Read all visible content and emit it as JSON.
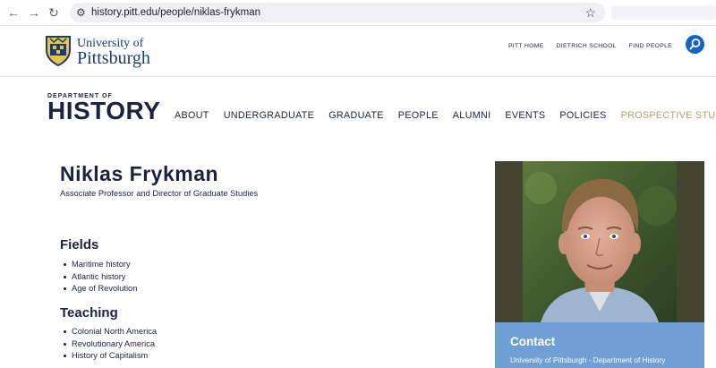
{
  "browser": {
    "url": "history.pitt.edu/people/niklas-frykman"
  },
  "university": {
    "line1": "University of",
    "line2": "Pittsburgh"
  },
  "top_links": [
    "PITT HOME",
    "DIETRICH SCHOOL",
    "FIND PEOPLE"
  ],
  "department": {
    "small": "DEPARTMENT OF",
    "big": "HISTORY"
  },
  "main_nav": [
    "ABOUT",
    "UNDERGRADUATE",
    "GRADUATE",
    "PEOPLE",
    "ALUMNI",
    "EVENTS",
    "POLICIES",
    "PROSPECTIVE STUDENTS"
  ],
  "person": {
    "name": "Niklas Frykman",
    "title": "Associate Professor and Director of Graduate Studies"
  },
  "fields": {
    "heading": "Fields",
    "items": [
      "Maritime history",
      "Atlantic history",
      "Age of Revolution"
    ]
  },
  "teaching": {
    "heading": "Teaching",
    "items": [
      "Colonial North America",
      "Revolutionary America",
      "History of Capitalism"
    ]
  },
  "contact": {
    "heading": "Contact",
    "line1": "University of Pittsburgh - Department of History"
  },
  "colors": {
    "navy": "#1c2340",
    "gold": "#b5a16a",
    "contact_bg": "#6f9fd4",
    "search_blue": "#1565c0"
  }
}
